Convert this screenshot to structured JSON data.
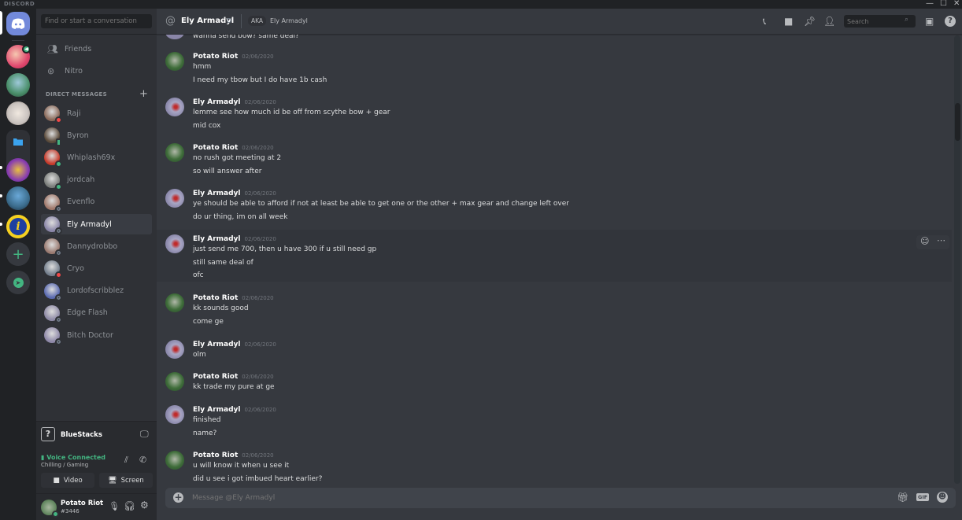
{
  "app": {
    "brand": "DISCORD",
    "window_controls": [
      "—",
      "☐",
      "✕"
    ]
  },
  "guilds": {
    "home_icon": "discord-logo-icon",
    "items": [
      {
        "name": "server-1",
        "color": "#e0486e",
        "badge": "speaker-icon"
      },
      {
        "name": "server-2",
        "color": "#4a8f6a"
      },
      {
        "name": "server-3",
        "color": "#c9c3bf"
      },
      {
        "name": "folder",
        "color": "#2f3136",
        "icon": "folder-icon"
      },
      {
        "name": "server-4",
        "color": "#8a3fb0"
      },
      {
        "name": "server-5",
        "color": "#3b6c8c"
      },
      {
        "name": "server-6",
        "color": "#1d3fa0",
        "label": "i"
      }
    ],
    "add_server": "+",
    "explore": "compass-icon"
  },
  "sidebar": {
    "search_placeholder": "Find or start a conversation",
    "nav": [
      {
        "label": "Friends",
        "icon": "friends-icon"
      },
      {
        "label": "Nitro",
        "icon": "nitro-icon"
      }
    ],
    "dm_header": "DIRECT MESSAGES",
    "dm_add": "+",
    "dms": [
      {
        "name": "Raji",
        "status": "dnd",
        "color": "#8b6a5a"
      },
      {
        "name": "Byron",
        "status": "mob",
        "color": "#5a4a3a"
      },
      {
        "name": "Whiplash69x",
        "status": "on",
        "color": "#c73a2a"
      },
      {
        "name": "jordcah",
        "status": "on",
        "color": "#7a7d7a"
      },
      {
        "name": "Evenflo",
        "status": "off",
        "color": "#a0786a"
      },
      {
        "name": "Ely Armadyl",
        "status": "off",
        "color": "#8a86a8",
        "active": true
      },
      {
        "name": "Dannydrobbo",
        "status": "off",
        "color": "#9a7a70"
      },
      {
        "name": "Cryo",
        "status": "dnd",
        "color": "#747f8d"
      },
      {
        "name": "Lordofscribblez",
        "status": "off",
        "color": "#5a6ab0"
      },
      {
        "name": "Edge Flash",
        "status": "off",
        "color": "#8e8aa6"
      },
      {
        "name": "Bitch Doctor",
        "status": "off",
        "color": "#8e88a8"
      }
    ],
    "activity": {
      "name": "BlueStacks",
      "icon": "question-icon"
    },
    "voice": {
      "status": "Voice Connected",
      "channel": "Chilling / Gaming",
      "video_label": "Video",
      "screen_label": "Screen"
    },
    "user": {
      "name": "Potato Riot",
      "tag": "#3446"
    }
  },
  "chat": {
    "recipient": "Ely Armadyl",
    "aka_label": "AKA",
    "aka_name": "Ely Armadyl",
    "search_placeholder": "Search",
    "composer_placeholder": "Message @Ely Armadyl",
    "top_partial": "wanna send bow? same deal?",
    "messages": [
      {
        "author": "Potato Riot",
        "date": "02/06/2020",
        "lines": [
          "hmm",
          "I need my tbow but I do have 1b cash"
        ]
      },
      {
        "author": "Ely Armadyl",
        "date": "02/06/2020",
        "lines": [
          "lemme see how much id be off from scythe bow + gear",
          "mid cox"
        ]
      },
      {
        "author": "Potato Riot",
        "date": "02/06/2020",
        "lines": [
          "no rush got meeting at 2",
          "so will answer after"
        ]
      },
      {
        "author": "Ely Armadyl",
        "date": "02/06/2020",
        "lines": [
          "ye should be able to afford if not at least be able to get one or the other + max gear and change left over",
          "do ur thing, im on all week"
        ]
      },
      {
        "author": "Ely Armadyl",
        "date": "02/06/2020",
        "lines": [
          "just send me 700, then u have 300 if u still need gp",
          "still same deal of",
          "ofc"
        ]
      },
      {
        "author": "Potato Riot",
        "date": "02/06/2020",
        "lines": [
          "kk sounds good",
          "come ge"
        ]
      },
      {
        "author": "Ely Armadyl",
        "date": "02/06/2020",
        "lines": [
          "olm"
        ]
      },
      {
        "author": "Potato Riot",
        "date": "02/06/2020",
        "lines": [
          "kk trade my pure at ge"
        ]
      },
      {
        "author": "Ely Armadyl",
        "date": "02/06/2020",
        "lines": [
          "finished",
          "name?"
        ]
      },
      {
        "author": "Potato Riot",
        "date": "02/06/2020",
        "lines": [
          "u will know it when u see it",
          "did u see i got imbued heart earlier?"
        ]
      }
    ]
  },
  "colors": {
    "accent": "#7289da",
    "online": "#43b581",
    "dnd": "#f04747",
    "voice": "#43b581"
  }
}
